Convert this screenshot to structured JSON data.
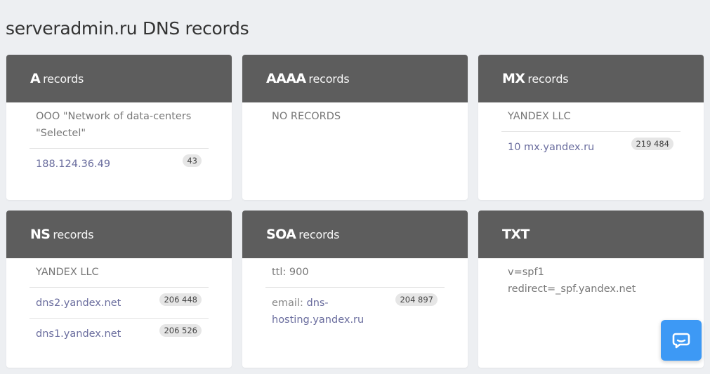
{
  "page": {
    "title": "serveradmin.ru DNS records"
  },
  "cards": {
    "a": {
      "type": "A",
      "suffix": "records",
      "owner": "OOO \"Network of data-centers \"Selectel\"",
      "records": [
        {
          "value": "188.124.36.49",
          "count": "43"
        }
      ]
    },
    "aaaa": {
      "type": "AAAA",
      "suffix": "records",
      "owner": "NO RECORDS"
    },
    "mx": {
      "type": "MX",
      "suffix": "records",
      "owner": "YANDEX LLC",
      "records": [
        {
          "value": "10 mx.yandex.ru",
          "count": "219 484"
        }
      ]
    },
    "ns": {
      "type": "NS",
      "suffix": "records",
      "owner": "YANDEX LLC",
      "records": [
        {
          "value": "dns2.yandex.net",
          "count": "206 448"
        },
        {
          "value": "dns1.yandex.net",
          "count": "206 526"
        }
      ]
    },
    "soa": {
      "type": "SOA",
      "suffix": "records",
      "owner": "ttl: 900",
      "records": [
        {
          "label": "email:",
          "value": "dns-hosting.yandex.ru",
          "count": "204 897"
        }
      ]
    },
    "txt": {
      "type": "TXT",
      "owner": "v=spf1 redirect=_spf.yandex.net"
    }
  },
  "chat": {
    "icon": "chat-bubble-icon",
    "color": "#3d99f5"
  },
  "colors": {
    "header": "#5d5d5d",
    "link": "#6a6d9e",
    "background": "#edeff2"
  }
}
